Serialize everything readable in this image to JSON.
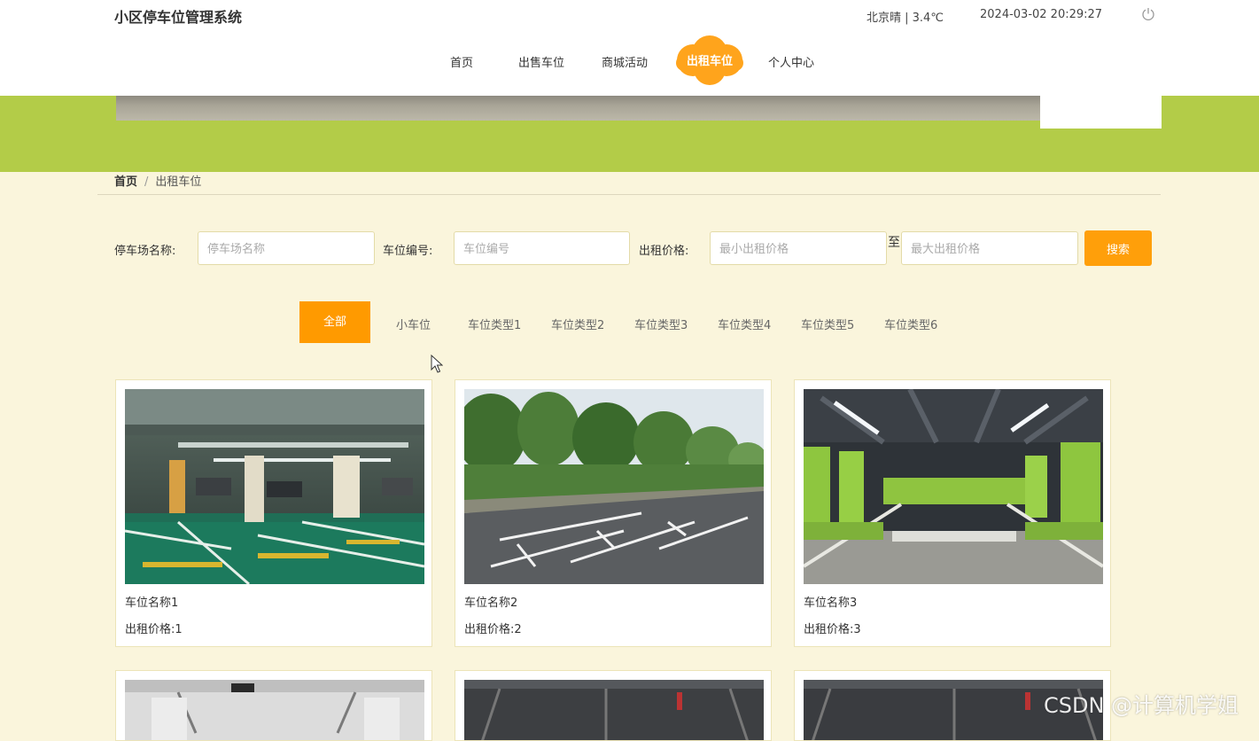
{
  "header": {
    "site_title": "小区停车位管理系统",
    "weather": "北京晴 | 3.4℃",
    "datetime": "2024-03-02  20:29:27",
    "power_icon": "power-icon"
  },
  "nav": {
    "home": "首页",
    "sell": "出售车位",
    "mall": "商城活动",
    "rent": "出租车位",
    "profile": "个人中心",
    "active": "出租车位"
  },
  "breadcrumb": {
    "home": "首页",
    "separator": "/",
    "current": "出租车位"
  },
  "search": {
    "lot_label": "停车场名称:",
    "lot_placeholder": "停车场名称",
    "space_label": "车位编号:",
    "space_placeholder": "车位编号",
    "price_label": "出租价格:",
    "min_placeholder": "最小出租价格",
    "to": "至",
    "max_placeholder": "最大出租价格",
    "button": "搜索"
  },
  "categories": [
    "全部",
    "小车位",
    "车位类型1",
    "车位类型2",
    "车位类型3",
    "车位类型4",
    "车位类型5",
    "车位类型6"
  ],
  "active_category": "全部",
  "cards": [
    {
      "name": "车位名称1",
      "price_label": "出租价格:",
      "price": "1"
    },
    {
      "name": "车位名称2",
      "price_label": "出租价格:",
      "price": "2"
    },
    {
      "name": "车位名称3",
      "price_label": "出租价格:",
      "price": "3"
    }
  ],
  "watermark": "CSDN @计算机学姐",
  "colors": {
    "accent": "#ff9f0a",
    "banner": "#b3cc48",
    "page_bg": "#faf5dc"
  }
}
